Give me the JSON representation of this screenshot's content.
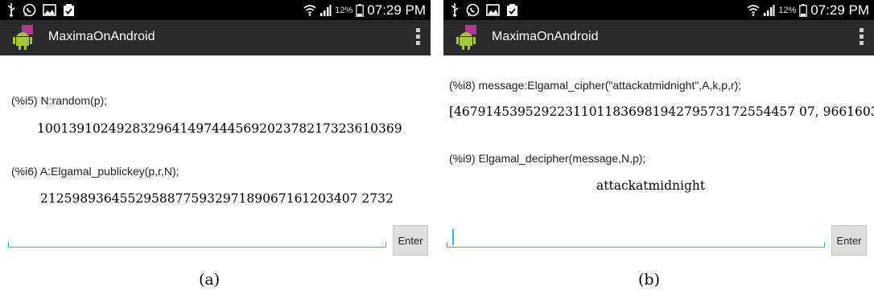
{
  "status_bar": {
    "battery_percent": "12%",
    "time": "07:29 PM"
  },
  "app": {
    "title": "MaximaOnAndroid"
  },
  "panel_a": {
    "caption": "(a)",
    "entries": [
      {
        "command": "(%i5) N:random(p);",
        "result": "1001391024928329641497444569202378217323610369"
      },
      {
        "command": "(%i6) A:Elgamal_publickey(p,r,N);",
        "result": "2125989364552958877593297189067161203407 2732"
      }
    ],
    "enter_label": "Enter"
  },
  "panel_b": {
    "caption": "(b)",
    "entries": [
      {
        "command": "(%i8) message:Elgamal_cipher(\"attackatmidnight\",A,k,p,r);",
        "result": "[4679145395292231101183698194279573172554457 07, 9661603"
      },
      {
        "command": "(%i9) Elgamal_decipher(message,N,p);",
        "result": "attackatmidnight"
      }
    ],
    "enter_label": "Enter"
  }
}
